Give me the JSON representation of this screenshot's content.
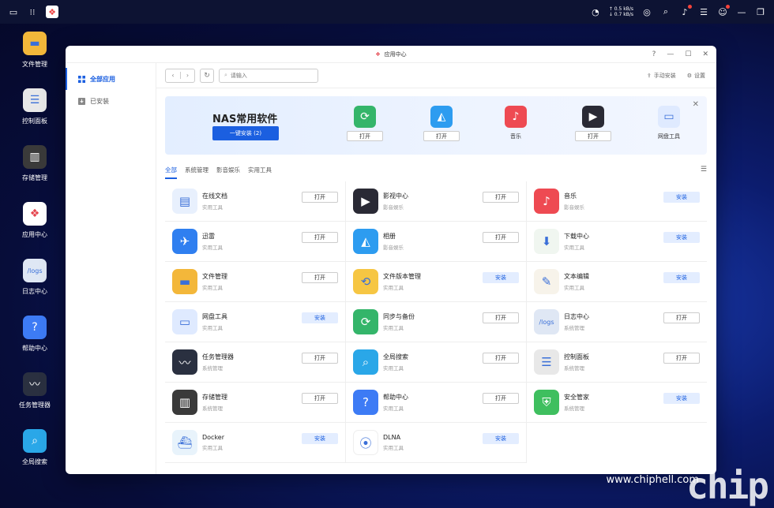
{
  "desktop": {
    "icons": [
      {
        "label": "文件管理",
        "color": "#f3b73a"
      },
      {
        "label": "控制面板",
        "color": "#e8e8e8"
      },
      {
        "label": "存储管理",
        "color": "#3a3a3a"
      },
      {
        "label": "应用中心",
        "color": "#ffffff"
      },
      {
        "label": "日志中心",
        "color": "#dfe7f4"
      },
      {
        "label": "帮助中心",
        "color": "#3d7bf5"
      },
      {
        "label": "任务管理器",
        "color": "#2a3040"
      },
      {
        "label": "全局搜索",
        "color": "#2aa7e8"
      }
    ]
  },
  "topbar": {
    "net_up": "↑ 0.5 kB/s",
    "net_down": "↓ 0.7 kB/s"
  },
  "window": {
    "title": "应用中心",
    "sidebar": [
      {
        "label": "全部应用",
        "active": true
      },
      {
        "label": "已安装",
        "active": false
      }
    ],
    "search_placeholder": "请输入",
    "manual_install": "手动安装",
    "settings": "设置",
    "banner": {
      "title": "NAS常用软件",
      "button": "一键安装 (2)",
      "apps": [
        {
          "icon": "sync-icon",
          "color": "#34b56a",
          "action": "打开"
        },
        {
          "icon": "photos-icon",
          "color": "#2d9cf0",
          "action": "打开"
        },
        {
          "icon": "music-icon",
          "color": "#ee4a52",
          "label": "音乐"
        },
        {
          "icon": "video-icon",
          "color": "#2a2a35",
          "action": "打开"
        },
        {
          "icon": "cloud-drive-icon",
          "color": "#dfeaff",
          "label": "网盘工具"
        }
      ]
    },
    "categories": [
      "全部",
      "系统管理",
      "影音娱乐",
      "实用工具"
    ],
    "apps": [
      {
        "name": "在线文档",
        "category": "实用工具",
        "button": "打开",
        "type": "open",
        "color": "#e8f0fd",
        "icon": "document-icon"
      },
      {
        "name": "影视中心",
        "category": "影音娱乐",
        "button": "打开",
        "type": "open",
        "color": "#2a2a35",
        "icon": "video-icon"
      },
      {
        "name": "音乐",
        "category": "影音娱乐",
        "button": "安装",
        "type": "install",
        "color": "#ee4a52",
        "icon": "music-icon"
      },
      {
        "name": "迅雷",
        "category": "实用工具",
        "button": "打开",
        "type": "open",
        "color": "#2f7ff0",
        "icon": "bird-icon"
      },
      {
        "name": "相册",
        "category": "影音娱乐",
        "button": "打开",
        "type": "open",
        "color": "#2d9cf0",
        "icon": "photos-icon"
      },
      {
        "name": "下载中心",
        "category": "实用工具",
        "button": "安装",
        "type": "install",
        "color": "#f0f6f0",
        "icon": "download-icon"
      },
      {
        "name": "文件管理",
        "category": "实用工具",
        "button": "打开",
        "type": "open",
        "color": "#f3b73a",
        "icon": "folder-icon"
      },
      {
        "name": "文件版本管理",
        "category": "实用工具",
        "button": "安装",
        "type": "install",
        "color": "#f6c643",
        "icon": "version-icon"
      },
      {
        "name": "文本编辑",
        "category": "实用工具",
        "button": "安装",
        "type": "install",
        "color": "#f7f3ea",
        "icon": "notepad-icon"
      },
      {
        "name": "网盘工具",
        "category": "实用工具",
        "button": "安装",
        "type": "install",
        "color": "#dfeaff",
        "icon": "cloud-drive-icon"
      },
      {
        "name": "同步与备份",
        "category": "实用工具",
        "button": "打开",
        "type": "open",
        "color": "#34b56a",
        "icon": "sync-icon"
      },
      {
        "name": "日志中心",
        "category": "系统管理",
        "button": "打开",
        "type": "open",
        "color": "#dfe7f4",
        "icon": "logs-icon"
      },
      {
        "name": "任务管理器",
        "category": "系统管理",
        "button": "打开",
        "type": "open",
        "color": "#2a3040",
        "icon": "task-manager-icon"
      },
      {
        "name": "全局搜索",
        "category": "实用工具",
        "button": "打开",
        "type": "open",
        "color": "#2aa7e8",
        "icon": "search-icon"
      },
      {
        "name": "控制面板",
        "category": "系统管理",
        "button": "打开",
        "type": "open",
        "color": "#e8e8e8",
        "icon": "control-panel-icon"
      },
      {
        "name": "存储管理",
        "category": "系统管理",
        "button": "打开",
        "type": "open",
        "color": "#3a3a3a",
        "icon": "storage-icon"
      },
      {
        "name": "帮助中心",
        "category": "实用工具",
        "button": "打开",
        "type": "open",
        "color": "#3d7bf5",
        "icon": "help-icon"
      },
      {
        "name": "安全管家",
        "category": "系统管理",
        "button": "安装",
        "type": "install",
        "color": "#3fbf5f",
        "icon": "shield-icon"
      },
      {
        "name": "Docker",
        "category": "实用工具",
        "button": "安装",
        "type": "install",
        "color": "#e8f3fb",
        "icon": "docker-icon"
      },
      {
        "name": "DLNA",
        "category": "实用工具",
        "button": "安装",
        "type": "install",
        "color": "#ffffff",
        "icon": "dlna-icon"
      }
    ]
  },
  "watermark": {
    "text": "chip",
    "site": "www.chiphell.com"
  }
}
